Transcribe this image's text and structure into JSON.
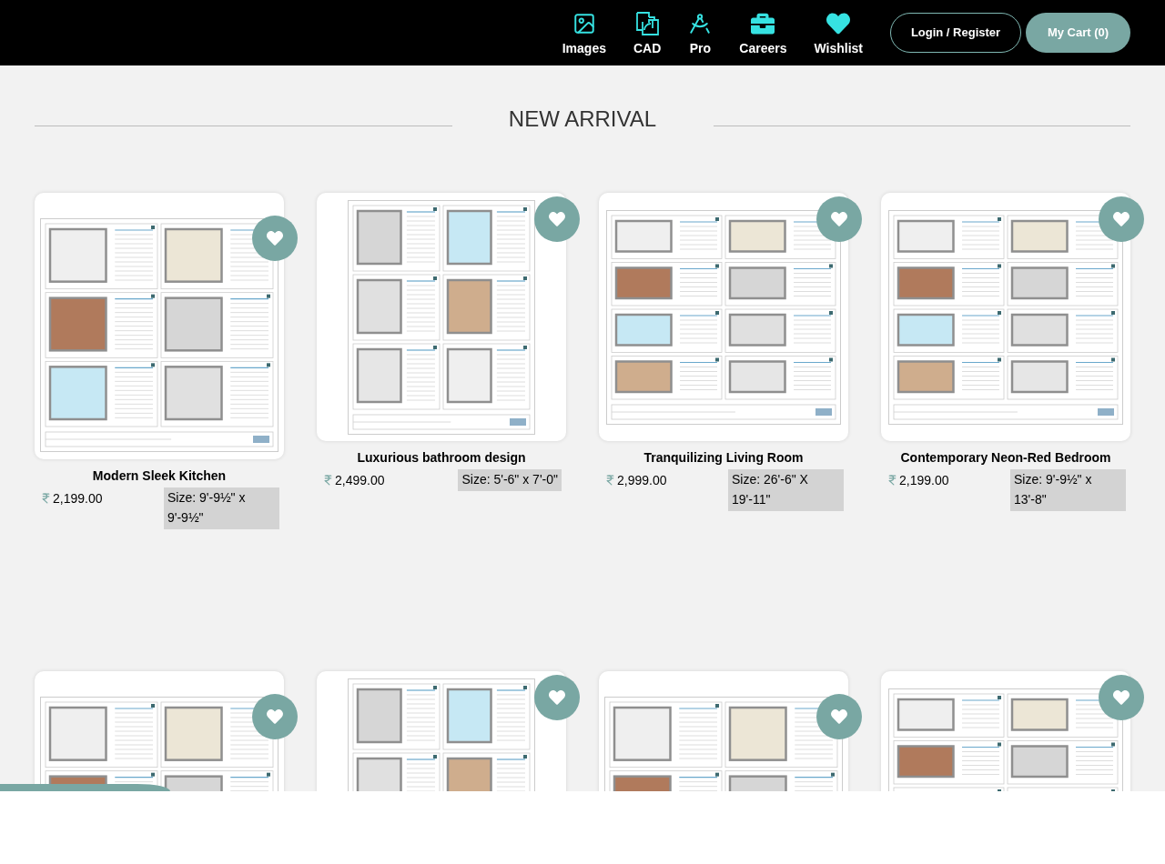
{
  "header": {
    "nav": [
      {
        "kind": "image",
        "label": "Images"
      },
      {
        "kind": "plan",
        "label": "CAD"
      },
      {
        "kind": "compass",
        "label": "Pro"
      },
      {
        "kind": "briefcase",
        "label": "Careers"
      },
      {
        "kind": "heart",
        "label": "Wishlist"
      }
    ],
    "login_button": "Login / Register",
    "cart_button": "My Cart (0)"
  },
  "section": {
    "title": "NEW ARRIVAL"
  },
  "products": [
    {
      "kind": "square",
      "title": "Modern Sleek Kitchen",
      "price": "2,199.00",
      "size": "Size: 9'-9½\" x 9'-9½\""
    },
    {
      "kind": "portrait",
      "title": "Luxurious bathroom design",
      "price": "2,499.00",
      "size": "Size: 5'-6\" x 7'-0\""
    },
    {
      "kind": "landscape",
      "title": "Tranquilizing Living Room",
      "price": "2,999.00",
      "size": "Size: 26'-6\" X 19'-11\""
    },
    {
      "kind": "landscape",
      "title": "Contemporary Neon-Red Bedroom",
      "price": "2,199.00",
      "size": "Size: 9'-9½\" x 13'-8\""
    },
    {
      "kind": "square"
    },
    {
      "kind": "portrait"
    },
    {
      "kind": "square"
    },
    {
      "kind": "landscape"
    }
  ]
}
